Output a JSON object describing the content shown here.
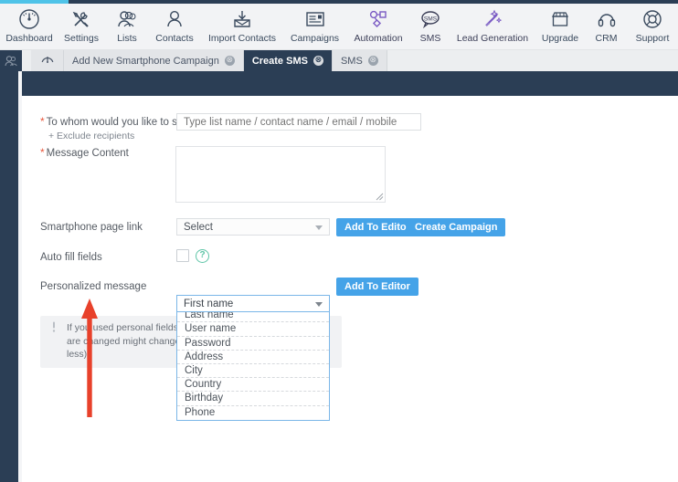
{
  "toolbar": {
    "items": [
      {
        "label": "Dashboard",
        "icon": "gauge-icon"
      },
      {
        "label": "Settings",
        "icon": "tools-icon"
      },
      {
        "label": "Lists",
        "icon": "people-group-icon"
      },
      {
        "label": "Contacts",
        "icon": "person-icon"
      },
      {
        "label": "Import Contacts",
        "icon": "inbox-download-icon"
      },
      {
        "label": "Campaigns",
        "icon": "newsletter-icon"
      },
      {
        "label": "Automation",
        "icon": "workflow-nodes-icon"
      },
      {
        "label": "SMS",
        "icon": "sms-bubble-icon"
      },
      {
        "label": "Lead Generation",
        "icon": "magic-wand-icon"
      },
      {
        "label": "Upgrade",
        "icon": "storefront-icon"
      },
      {
        "label": "CRM",
        "icon": "headset-icon"
      },
      {
        "label": "Support",
        "icon": "lifebuoy-icon"
      }
    ]
  },
  "tabs": {
    "corner_icon": "contacts-group-icon",
    "home_icon": "gauge-icon",
    "close_glyph": "⊗",
    "items": [
      {
        "label": "Add New Smartphone Campaign",
        "active": false
      },
      {
        "label": "Create SMS",
        "active": true
      },
      {
        "label": "SMS",
        "active": false
      }
    ]
  },
  "form": {
    "recipients": {
      "label": "To whom would you like to send?",
      "required_marker": "*",
      "exclude_link": "+ Exclude recipients",
      "placeholder": "Type list name / contact name / email / mobile",
      "value": ""
    },
    "message_content": {
      "label": "Message Content",
      "required_marker": "*",
      "value": ""
    },
    "smartphone_page_link": {
      "label": "Smartphone page link",
      "selected": "Select",
      "add_to_editor_label": "Add To Editor",
      "create_campaign_label": "Create Campaign"
    },
    "auto_fill_fields": {
      "label": "Auto fill fields",
      "checked": false,
      "help_glyph": "?"
    },
    "personalized_message": {
      "label": "Personalized message",
      "selected": "First name",
      "add_to_editor_label": "Add To Editor",
      "options": [
        "First name",
        "Last name",
        "User name",
        "Password",
        "Address",
        "City",
        "Country",
        "Birthday",
        "Phone"
      ]
    },
    "info_note": {
      "icon_glyph": "ℹ",
      "line1": "If you used personal fields or au",
      "line2": "are changed might change accor",
      "line3": "less) ."
    }
  },
  "colors": {
    "navy": "#2b3e55",
    "accent_blue": "#45a3e8",
    "progress_blue": "#4fc3e8",
    "required_red": "#e8553a",
    "arrow_red": "#e8412b",
    "help_green": "#5ec5a7"
  }
}
